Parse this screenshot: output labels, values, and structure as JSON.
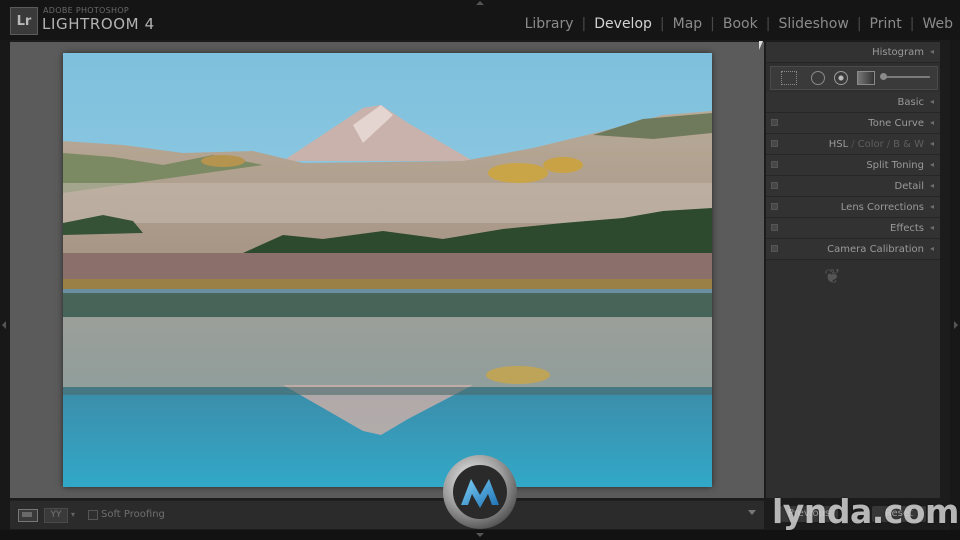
{
  "app": {
    "badge": "Lr",
    "vendor": "ADOBE PHOTOSHOP",
    "name": "LIGHTROOM 4"
  },
  "modules": [
    {
      "label": "Library",
      "active": false
    },
    {
      "label": "Develop",
      "active": true
    },
    {
      "label": "Map",
      "active": false
    },
    {
      "label": "Book",
      "active": false
    },
    {
      "label": "Slideshow",
      "active": false
    },
    {
      "label": "Print",
      "active": false
    },
    {
      "label": "Web",
      "active": false
    }
  ],
  "right_panel": {
    "histogram": "Histogram",
    "tools": [
      "crop-overlay-icon",
      "spot-removal-icon",
      "red-eye-icon",
      "graduated-filter-icon",
      "adjustment-brush-icon"
    ],
    "sections": {
      "basic": "Basic",
      "tone_curve": "Tone Curve",
      "hsl": "HSL",
      "color": "Color",
      "bw": "B & W",
      "split_toning": "Split Toning",
      "detail": "Detail",
      "lens_corrections": "Lens Corrections",
      "effects": "Effects",
      "camera_calibration": "Camera Calibration"
    },
    "collapse_glyph": "◂",
    "end_ornament": "❦"
  },
  "toolbar": {
    "yy_label": "YY",
    "soft_proofing": "Soft Proofing",
    "soft_proofing_checked": false
  },
  "bottom_buttons": {
    "previous": "Previous",
    "reset": "Reset"
  },
  "watermark": {
    "site": "lynda.com"
  },
  "colors": {
    "active_module": "#d3d3d3",
    "inactive_module": "#8b8b8b",
    "panel_bg": "#2f2f2f",
    "canvas_bg": "#5b5b5b"
  }
}
